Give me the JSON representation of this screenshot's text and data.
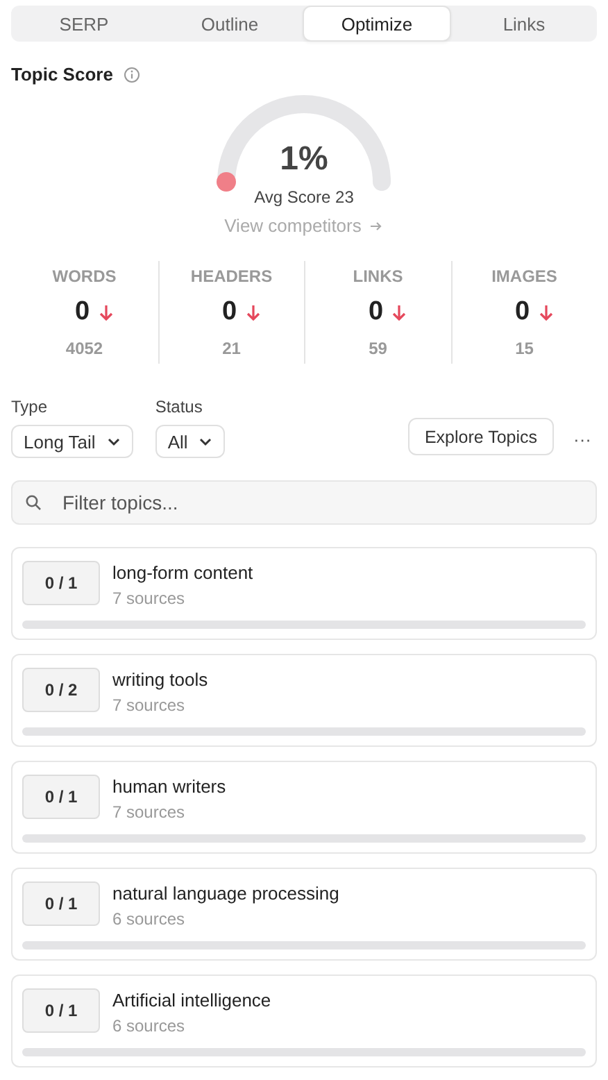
{
  "tabs": [
    {
      "label": "SERP",
      "selected": false
    },
    {
      "label": "Outline",
      "selected": false
    },
    {
      "label": "Optimize",
      "selected": true
    },
    {
      "label": "Links",
      "selected": false
    }
  ],
  "topic_score": {
    "title": "Topic Score",
    "value": "1%",
    "avg": "Avg Score 23",
    "link": "View competitors"
  },
  "stats": [
    {
      "label": "WORDS",
      "value": "0",
      "target": "4052"
    },
    {
      "label": "HEADERS",
      "value": "0",
      "target": "21"
    },
    {
      "label": "LINKS",
      "value": "0",
      "target": "59"
    },
    {
      "label": "IMAGES",
      "value": "0",
      "target": "15"
    }
  ],
  "filters": [
    {
      "label": "Type",
      "value": "Long Tail"
    },
    {
      "label": "Status",
      "value": "All"
    }
  ],
  "explore_button": "Explore Topics",
  "more": "···",
  "search": {
    "placeholder": "Filter topics..."
  },
  "topics": [
    {
      "count": "0 / 1",
      "name": "long-form content",
      "sources": "7 sources",
      "level": 0
    },
    {
      "count": "0 / 2",
      "name": "writing tools",
      "sources": "7 sources",
      "level": 0
    },
    {
      "count": "0 / 1",
      "name": "human writers",
      "sources": "7 sources",
      "level": 0
    },
    {
      "count": "0 / 1",
      "name": "natural language processing",
      "sources": "6 sources",
      "level": 0
    },
    {
      "count": "0 / 1",
      "name": "Artificial intelligence",
      "sources": "6 sources",
      "level": 0
    }
  ]
}
